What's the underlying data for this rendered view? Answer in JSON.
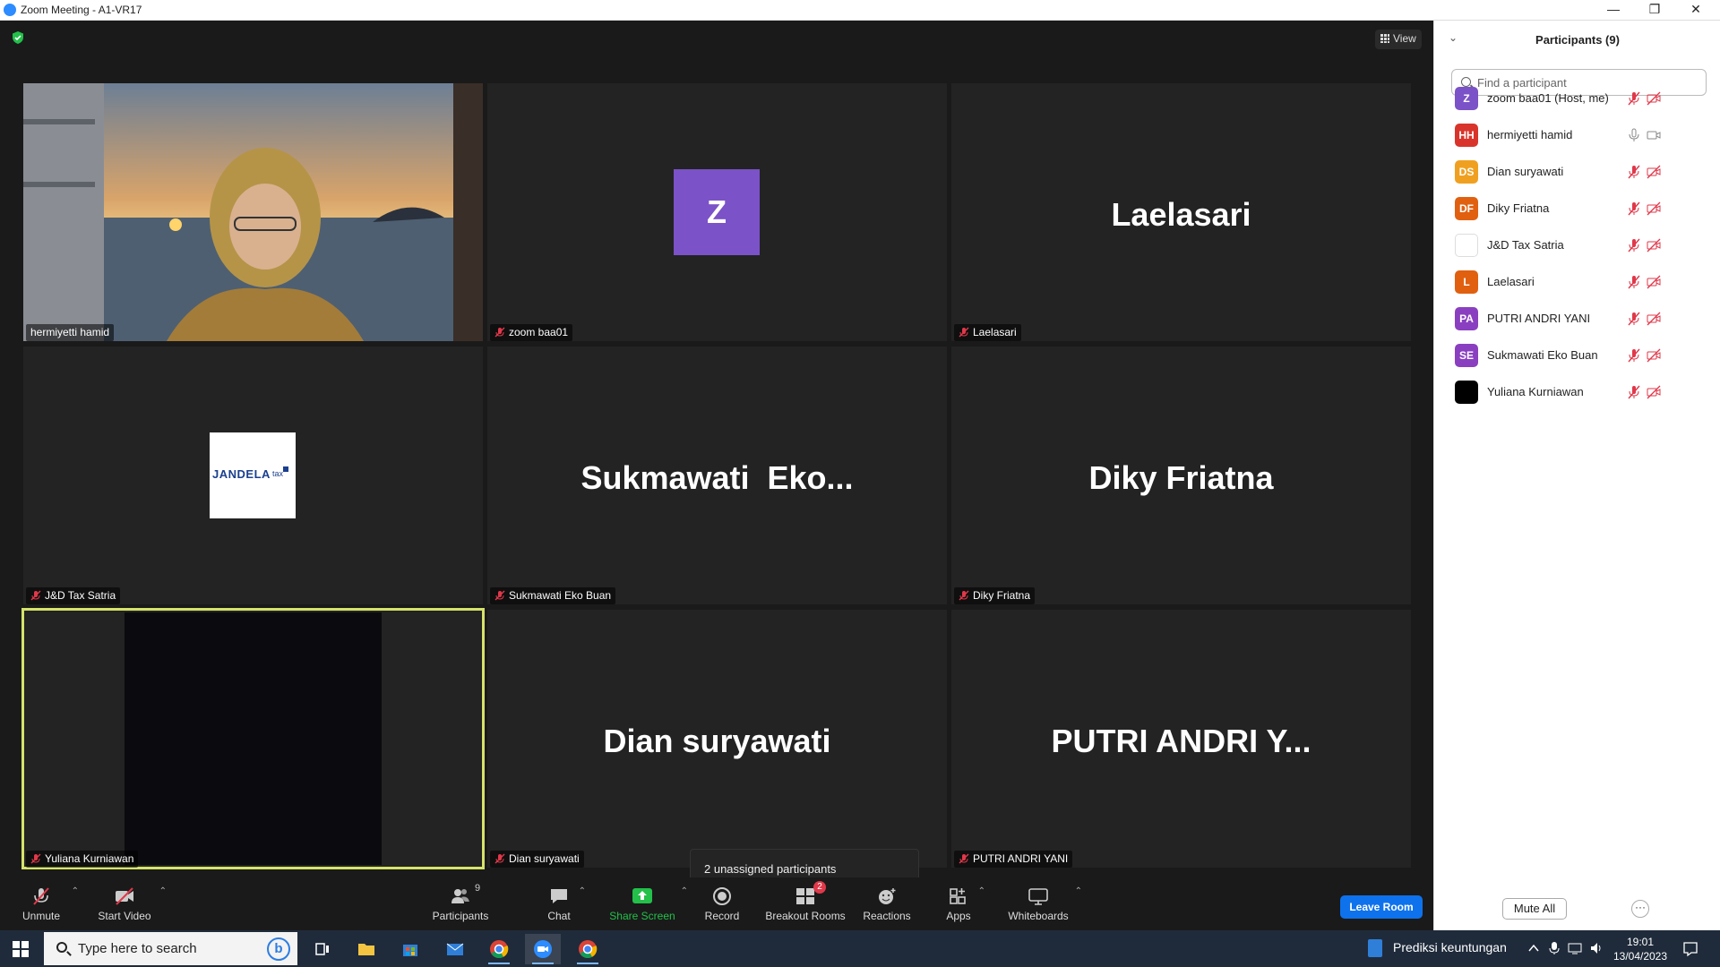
{
  "window": {
    "title": "Zoom Meeting - A1-VR17",
    "controls": [
      "—",
      "❐",
      "✕"
    ]
  },
  "meeting": {
    "view_label": "View",
    "tiles": [
      {
        "name": "hermiyetti hamid",
        "big_text": "",
        "muted": false,
        "type": "video"
      },
      {
        "name": "zoom baa01",
        "big_text": "Z",
        "muted": true,
        "type": "avatar"
      },
      {
        "name": "Laelasari",
        "big_text": "Laelasari",
        "muted": true,
        "type": "name"
      },
      {
        "name": "J&D Tax Satria",
        "big_text": "",
        "muted": true,
        "type": "logo"
      },
      {
        "name": "Sukmawati Eko Buan",
        "big_text": "Sukmawati  Eko...",
        "muted": true,
        "type": "name"
      },
      {
        "name": "Diky Friatna",
        "big_text": "Diky Friatna",
        "muted": true,
        "type": "name"
      },
      {
        "name": "Yuliana Kurniawan",
        "big_text": "",
        "muted": true,
        "type": "dark"
      },
      {
        "name": "Dian suryawati",
        "big_text": "Dian suryawati",
        "muted": true,
        "type": "name"
      },
      {
        "name": "PUTRI ANDRI YANI",
        "big_text": "PUTRI ANDRI Y...",
        "muted": true,
        "type": "name"
      }
    ],
    "logo_text": "JANDELA",
    "logo_sub": "tax",
    "unassigned_tooltip": "2 unassigned participants"
  },
  "toolbar": {
    "unmute": "Unmute",
    "start_video": "Start Video",
    "participants": "Participants",
    "participants_count": "9",
    "chat": "Chat",
    "share_screen": "Share Screen",
    "record": "Record",
    "breakout_rooms": "Breakout Rooms",
    "breakout_badge": "2",
    "reactions": "Reactions",
    "apps": "Apps",
    "whiteboards": "Whiteboards",
    "leave_room": "Leave Room"
  },
  "panel": {
    "title": "Participants (9)",
    "search_placeholder": "Find a participant",
    "participants": [
      {
        "name": "zoom baa01 (Host, me)",
        "initials": "Z",
        "color": "#7b52c7",
        "mic_muted": true,
        "video_off": true
      },
      {
        "name": "hermiyetti hamid",
        "initials": "HH",
        "color": "#d9342b",
        "mic_muted": false,
        "video_off": false
      },
      {
        "name": "Dian suryawati",
        "initials": "DS",
        "color": "#f0a020",
        "mic_muted": true,
        "video_off": true
      },
      {
        "name": "Diky Friatna",
        "initials": "DF",
        "color": "#e06010",
        "mic_muted": true,
        "video_off": true
      },
      {
        "name": "J&D Tax Satria",
        "initials": "",
        "color": "#ffffff",
        "mic_muted": true,
        "video_off": true
      },
      {
        "name": "Laelasari",
        "initials": "L",
        "color": "#e06010",
        "mic_muted": true,
        "video_off": true
      },
      {
        "name": "PUTRI ANDRI YANI",
        "initials": "PA",
        "color": "#8a3fc0",
        "mic_muted": true,
        "video_off": true
      },
      {
        "name": "Sukmawati Eko Buan",
        "initials": "SE",
        "color": "#8a3fc0",
        "mic_muted": true,
        "video_off": true
      },
      {
        "name": "Yuliana Kurniawan",
        "initials": "",
        "color": "#000000",
        "mic_muted": true,
        "video_off": true
      }
    ],
    "mute_all": "Mute All",
    "more": "···"
  },
  "taskbar": {
    "search_placeholder": "Type here to search",
    "bing": "b",
    "news": "Prediksi keuntungan",
    "time": "19:01",
    "date": "13/04/2023"
  },
  "colors": {
    "accent": "#0e72ed",
    "active_speaker": "#d6e36b",
    "share_green": "#23c04a",
    "muted_red": "#e0384a"
  }
}
